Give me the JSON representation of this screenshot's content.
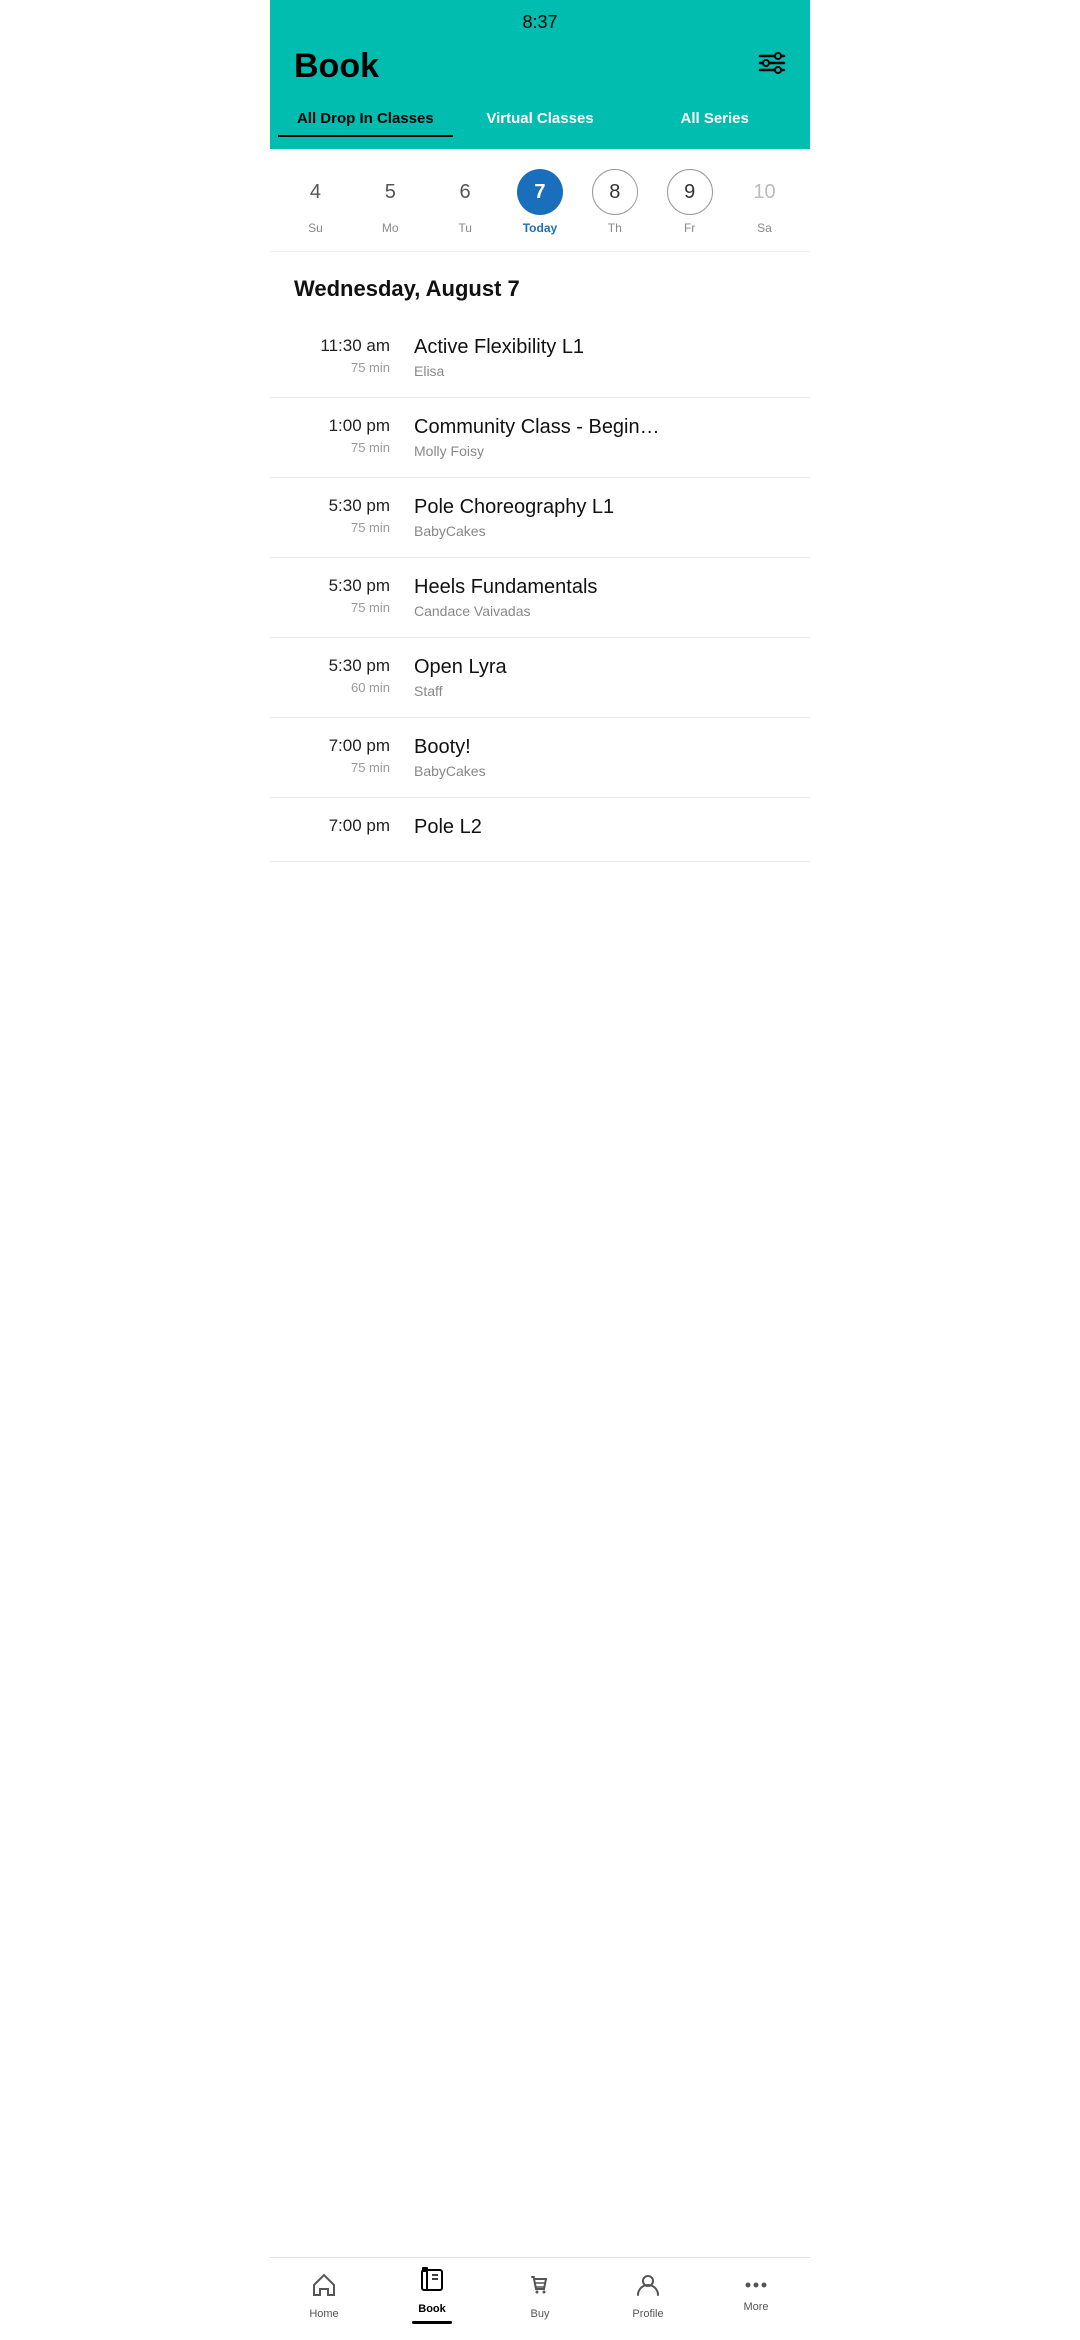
{
  "statusBar": {
    "time": "8:37"
  },
  "header": {
    "title": "Book",
    "filterIcon": "≡"
  },
  "tabs": [
    {
      "id": "drop-in",
      "label": "All Drop In Classes",
      "active": true
    },
    {
      "id": "virtual",
      "label": "Virtual Classes",
      "active": false
    },
    {
      "id": "series",
      "label": "All Series",
      "active": false
    }
  ],
  "calendar": {
    "days": [
      {
        "number": "4",
        "label": "Su",
        "state": "normal"
      },
      {
        "number": "5",
        "label": "Mo",
        "state": "normal"
      },
      {
        "number": "6",
        "label": "Tu",
        "state": "normal"
      },
      {
        "number": "7",
        "label": "Today",
        "state": "selected"
      },
      {
        "number": "8",
        "label": "Th",
        "state": "outlined"
      },
      {
        "number": "9",
        "label": "Fr",
        "state": "outlined"
      },
      {
        "number": "10",
        "label": "Sa",
        "state": "faded"
      }
    ]
  },
  "dateHeading": "Wednesday, August 7",
  "classes": [
    {
      "time": "11:30 am",
      "duration": "75 min",
      "name": "Active Flexibility L1",
      "instructor": "Elisa"
    },
    {
      "time": "1:00 pm",
      "duration": "75 min",
      "name": "Community Class - Begin…",
      "instructor": "Molly Foisy"
    },
    {
      "time": "5:30 pm",
      "duration": "75 min",
      "name": "Pole Choreography L1",
      "instructor": "BabyCakes"
    },
    {
      "time": "5:30 pm",
      "duration": "75 min",
      "name": "Heels Fundamentals",
      "instructor": "Candace Vaivadas"
    },
    {
      "time": "5:30 pm",
      "duration": "60 min",
      "name": "Open Lyra",
      "instructor": "Staff"
    },
    {
      "time": "7:00 pm",
      "duration": "75 min",
      "name": "Booty!",
      "instructor": "BabyCakes"
    },
    {
      "time": "7:00 pm",
      "duration": "",
      "name": "Pole L2",
      "instructor": ""
    }
  ],
  "bottomNav": [
    {
      "id": "home",
      "label": "Home",
      "icon": "🏠",
      "active": false
    },
    {
      "id": "book",
      "label": "Book",
      "icon": "📅",
      "active": true
    },
    {
      "id": "buy",
      "label": "Buy",
      "icon": "🛍",
      "active": false
    },
    {
      "id": "profile",
      "label": "Profile",
      "icon": "👤",
      "active": false
    },
    {
      "id": "more",
      "label": "More",
      "icon": "•••",
      "active": false
    }
  ]
}
